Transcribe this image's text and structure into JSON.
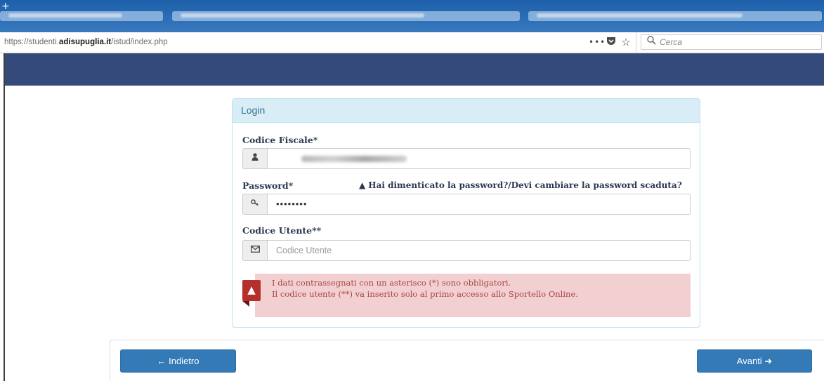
{
  "browser": {
    "url_prefix": "https://studenti.",
    "url_domain": "adisupuglia.it",
    "url_path": "/istud/index.php",
    "more_icon": "ellipsis-icon",
    "pocket_icon": "pocket-icon",
    "bookmark_icon": "star-icon",
    "search_icon": "magnifier-icon",
    "search_placeholder": "Cerca"
  },
  "login": {
    "heading": "Login",
    "codice_fiscale_label": "Codice Fiscale*",
    "password_label": "Password*",
    "password_value": "••••••••",
    "forgot_link": "Hai dimenticato la password?/Devi cambiare la password scaduta?",
    "codice_utente_label": "Codice Utente**",
    "codice_utente_placeholder": "Codice Utente",
    "user_icon": "user-icon",
    "key_icon": "key-icon",
    "envelope_icon": "envelope-icon",
    "warning_icon": "warning-triangle-icon"
  },
  "alert": {
    "line1": "I dati contrassegnati con un asterisco (*) sono obbligatori.",
    "line2": "Il codice utente (**) va inserito solo al primo accesso allo Sportello Online."
  },
  "footer": {
    "back_label": "← Indietro",
    "next_label": "Avanti ➜"
  },
  "colors": {
    "header": "#344a7b",
    "panel_heading_bg": "#d9edf7",
    "panel_heading_text": "#31708f",
    "alert_bg": "#f2d0d2",
    "alert_text": "#a94442",
    "button": "#337ab7"
  }
}
